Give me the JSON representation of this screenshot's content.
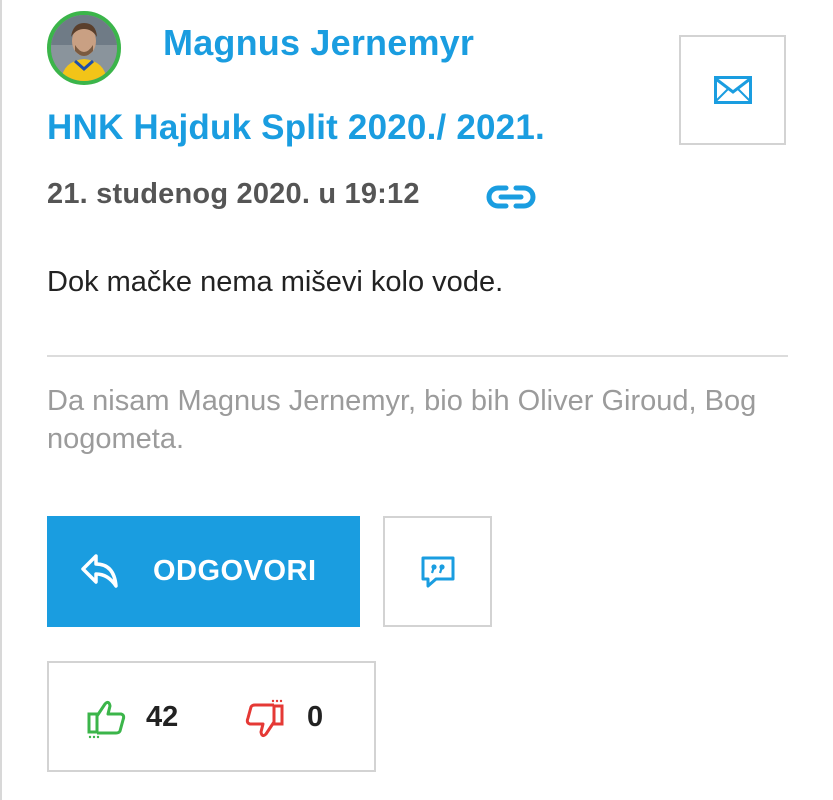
{
  "post": {
    "author": "Magnus Jernemyr",
    "topic": "HNK Hajduk Split 2020./ 2021.",
    "date": "21. studenog 2020. u 19:12",
    "body": "Dok mačke nema miševi kolo vode.",
    "signature": "Da nisam Magnus Jernemyr, bio bih Oliver Giroud, Bog nogometa."
  },
  "actions": {
    "reply_label": "ODGOVORI",
    "likes": "42",
    "dislikes": "0"
  },
  "icons": {
    "message": "envelope-icon",
    "permalink": "link-icon",
    "reply": "reply-arrow-icon",
    "quote": "quote-bubble-icon",
    "like": "thumbs-up-icon",
    "dislike": "thumbs-down-icon"
  },
  "colors": {
    "accent": "#1a9de0",
    "like": "#3bb54a",
    "dislike": "#e53935",
    "avatar_ring": "#3bb54a"
  }
}
